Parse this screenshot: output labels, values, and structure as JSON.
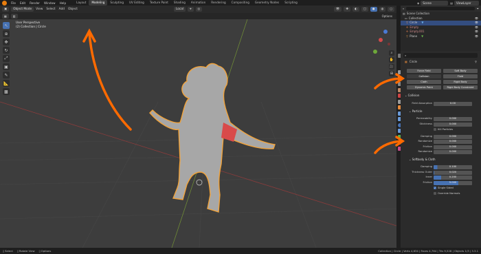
{
  "menu": [
    "File",
    "Edit",
    "Render",
    "Window",
    "Help"
  ],
  "workspaces": [
    "Layout",
    "Modeling",
    "Sculpting",
    "UV Editing",
    "Texture Paint",
    "Shading",
    "Animation",
    "Rendering",
    "Compositing",
    "Geometry Nodes",
    "Scripting"
  ],
  "active_workspace": "Modeling",
  "scene_label": "Scene",
  "viewlayer_label": "ViewLayer",
  "viewport_header": {
    "mode": "Object Mode",
    "menus": [
      "View",
      "Select",
      "Add",
      "Object"
    ],
    "transform": "Local",
    "options": "Options"
  },
  "viewport_info": {
    "line1": "User Perspective",
    "line2": "(2) Collection | Circle"
  },
  "outliner": {
    "title": "Scene Collection",
    "collection": "Collection",
    "items": [
      "Circle",
      "Empty",
      "Empty.001",
      "Plane"
    ]
  },
  "properties": {
    "object_name": "Circle",
    "physics_buttons": [
      [
        "Force Field",
        "Soft Body"
      ],
      [
        "Collision",
        "Fluid"
      ],
      [
        "Cloth",
        "Rigid Body"
      ],
      [
        "Dynamic Paint",
        "Rigid Body Constraint"
      ]
    ],
    "collision_section": "Collision",
    "field_absorption_label": "Field Absorption",
    "field_absorption_value": "0.00",
    "particle_section": "Particle",
    "permeability_label": "Permeability",
    "permeability_value": "0.000",
    "stickiness_label": "Stickiness",
    "stickiness_value": "0.000",
    "kill_particles_label": "Kill Particles",
    "damping_label": "Damping",
    "damping_value": "0.000",
    "randomize_label": "Randomize",
    "randomize_value": "0.000",
    "friction_label": "Friction",
    "friction_value": "0.000",
    "randomize2_label": "Randomize",
    "randomize2_value": "0.000",
    "softbody_section": "Softbody & Cloth",
    "sb_damping_label": "Damping",
    "sb_damping_value": "0.100",
    "thickness_outer_label": "Thickness Outer",
    "thickness_outer_value": "0.020",
    "inner_label": "Inner",
    "inner_value": "0.200",
    "sb_friction_label": "Friction",
    "sb_friction_value": "5.000",
    "single_sided_label": "Single Sided",
    "override_normals_label": "Override Normals"
  },
  "status_bar": {
    "left": [
      "Select",
      "Rotate View",
      "Options"
    ],
    "right": "Collection | Circle | Verts 4,634 | Faces 4,764 | Tris 9,528 | Objects 1/3 | 3.3.1"
  },
  "colors": {
    "accent": "#4772b3",
    "selection_outline": "#f2a33a",
    "annotation": "#ff6a00"
  }
}
